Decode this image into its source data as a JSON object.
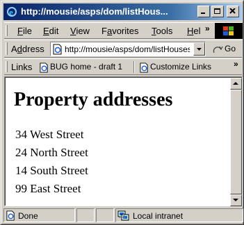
{
  "window": {
    "title": "http://mousie/asps/dom/listHous...",
    "controls": {
      "minimize": "minimize",
      "maximize": "maximize",
      "close": "close"
    }
  },
  "menubar": {
    "items": [
      {
        "accel": "F",
        "rest": "ile"
      },
      {
        "accel": "E",
        "rest": "dit"
      },
      {
        "accel": "V",
        "rest": "iew"
      },
      {
        "pre": "F",
        "accel": "a",
        "rest": "vorites"
      },
      {
        "accel": "T",
        "rest": "ools"
      },
      {
        "accel": "H",
        "rest": "el"
      }
    ],
    "overflow": "»"
  },
  "address_bar": {
    "label_accel": "d",
    "label_pre": "A",
    "label_rest": "dress",
    "value": "http://mousie/asps/dom/listHouses.asp",
    "go_label": "Go"
  },
  "links_bar": {
    "label": "Links",
    "items": [
      {
        "label": "BUG home - draft 1",
        "icon": "ie-page-icon"
      },
      {
        "label": "Customize Links",
        "icon": "ie-page-icon"
      }
    ],
    "overflow": "»"
  },
  "page": {
    "heading": "Property addresses",
    "addresses": [
      "34 West Street",
      "24 North Street",
      "14 South Street",
      "99 East Street"
    ]
  },
  "status_bar": {
    "status_text": "Done",
    "zone_text": "Local intranet"
  },
  "colors": {
    "title_start": "#0a246a",
    "title_end": "#a6caf0",
    "chrome": "#d4d0c8"
  }
}
